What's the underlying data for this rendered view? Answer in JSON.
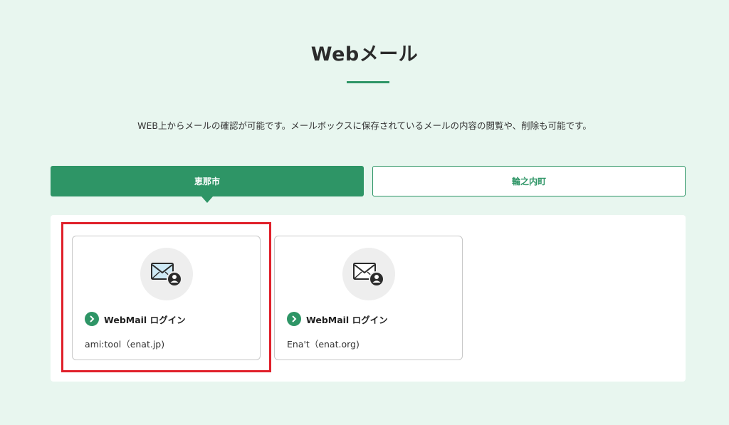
{
  "title": "Webメール",
  "description": "WEB上からメールの確認が可能です。メールボックスに保存されているメールの内容の閲覧や、削除も可能です。",
  "tabs": [
    {
      "label": "恵那市",
      "active": true
    },
    {
      "label": "輪之内町",
      "active": false
    }
  ],
  "cards": [
    {
      "login_label": "WebMail ログイン",
      "domain": "ami:tool（enat.jp)",
      "icon": "mail-user-icon"
    },
    {
      "login_label": "WebMail ログイン",
      "domain": "Ena't（enat.org)",
      "icon": "mail-user-icon"
    }
  ],
  "colors": {
    "background": "#e8f6ef",
    "accent": "#2e9566",
    "highlight": "#e0202a"
  }
}
